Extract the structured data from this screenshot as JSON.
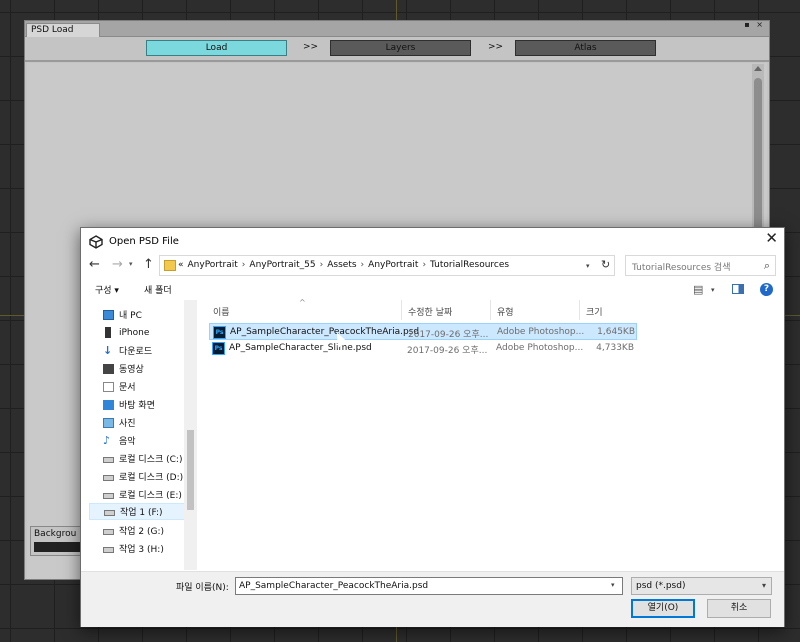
{
  "unity": {
    "tab_title": "PSD Load",
    "window_buttons": "▪ ×",
    "steps": [
      {
        "label": "Load",
        "active": true
      },
      {
        "label": "Layers",
        "active": false
      },
      {
        "label": "Atlas",
        "active": false
      }
    ],
    "step_arrow": ">>",
    "background_label": "Backgrou"
  },
  "dialog": {
    "title": "Open PSD File",
    "close_glyph": "✕",
    "nav": {
      "back": "←",
      "forward": "→",
      "dropdown": "▾",
      "up": "↑",
      "refresh": "↻"
    },
    "address_prefix": "«",
    "breadcrumbs": [
      "AnyPortrait",
      "AnyPortrait_55",
      "Assets",
      "AnyPortrait",
      "TutorialResources"
    ],
    "crumb_separator": "›",
    "search_placeholder": "TutorialResources 검색",
    "search_icon": "⌕",
    "toolbar": {
      "organize": "구성 ▾",
      "new_folder": "새 폴더",
      "view_icon": "▤",
      "help": "?"
    },
    "nav_pane": [
      {
        "label": "내 PC",
        "icon": "pc-icon"
      },
      {
        "label": "iPhone",
        "icon": "phone-icon"
      },
      {
        "label": "다운로드",
        "icon": "download-icon"
      },
      {
        "label": "동영상",
        "icon": "video-icon"
      },
      {
        "label": "문서",
        "icon": "document-icon"
      },
      {
        "label": "바탕 화면",
        "icon": "desktop-icon"
      },
      {
        "label": "사진",
        "icon": "pictures-icon"
      },
      {
        "label": "음악",
        "icon": "music-icon"
      },
      {
        "label": "로컬 디스크 (C:)",
        "icon": "drive-icon"
      },
      {
        "label": "로컬 디스크 (D:)",
        "icon": "drive-icon"
      },
      {
        "label": "로컬 디스크 (E:)",
        "icon": "drive-icon"
      },
      {
        "label": "작업 1 (F:)",
        "icon": "drive-icon",
        "selected": true
      },
      {
        "label": "작업 2 (G:)",
        "icon": "drive-icon"
      },
      {
        "label": "작업 3 (H:)",
        "icon": "drive-icon"
      }
    ],
    "columns": [
      "이름",
      "수정한 날짜",
      "유형",
      "크기"
    ],
    "sort_glyph": "^",
    "files": [
      {
        "name": "AP_SampleCharacter_PeacockTheAria.psd",
        "date": "2017-09-26 오후...",
        "type": "Adobe Photoshop...",
        "size": "1,645KB",
        "selected": true
      },
      {
        "name": "AP_SampleCharacter_Slime.psd",
        "date": "2017-09-26 오후...",
        "type": "Adobe Photoshop...",
        "size": "4,733KB",
        "selected": false
      }
    ],
    "file_icon_text": "Ps",
    "filename_label": "파일 이름(N):",
    "filename_value": "AP_SampleCharacter_PeacockTheAria.psd",
    "filetype_value": "psd (*.psd)",
    "open_button": "열기(O)",
    "cancel_button": "취소"
  },
  "colors": {
    "accent_step": "#7bd8dc",
    "selection": "#cce8ff",
    "dialog_blue": "#0078d7"
  }
}
